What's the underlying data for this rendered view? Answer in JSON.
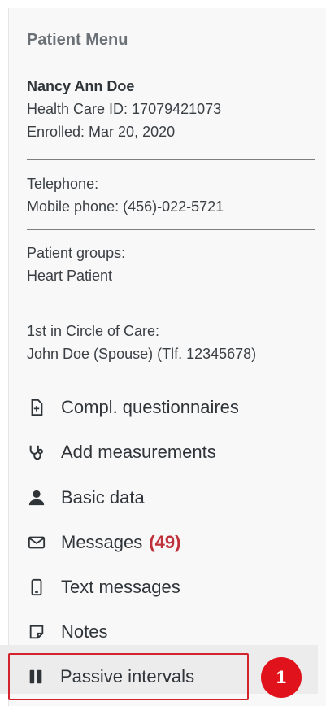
{
  "panel": {
    "title": "Patient Menu"
  },
  "patient": {
    "name": "Nancy Ann Doe",
    "health_care_id": "Health Care ID: 17079421073",
    "enrolled": "Enrolled: Mar 20, 2020"
  },
  "contact": {
    "telephone_label": "Telephone:",
    "mobile": "Mobile phone: (456)-022-5721"
  },
  "groups": {
    "label": "Patient groups:",
    "value": "Heart Patient"
  },
  "circle_of_care": {
    "label": "1st in Circle of Care:",
    "value": "John Doe (Spouse) (Tlf. 12345678)"
  },
  "menu": {
    "items": [
      {
        "label": "Compl. questionnaires",
        "icon": "document-plus-icon"
      },
      {
        "label": "Add measurements",
        "icon": "stethoscope-icon"
      },
      {
        "label": "Basic data",
        "icon": "person-icon"
      },
      {
        "label": "Messages",
        "count": "(49)",
        "icon": "envelope-icon"
      },
      {
        "label": "Text messages",
        "icon": "mobile-phone-icon"
      },
      {
        "label": "Notes",
        "icon": "note-icon"
      },
      {
        "label": "Passive intervals",
        "icon": "pause-icon",
        "selected": true
      }
    ]
  },
  "annotation": {
    "step_number": "1",
    "color": "#e0121c"
  }
}
